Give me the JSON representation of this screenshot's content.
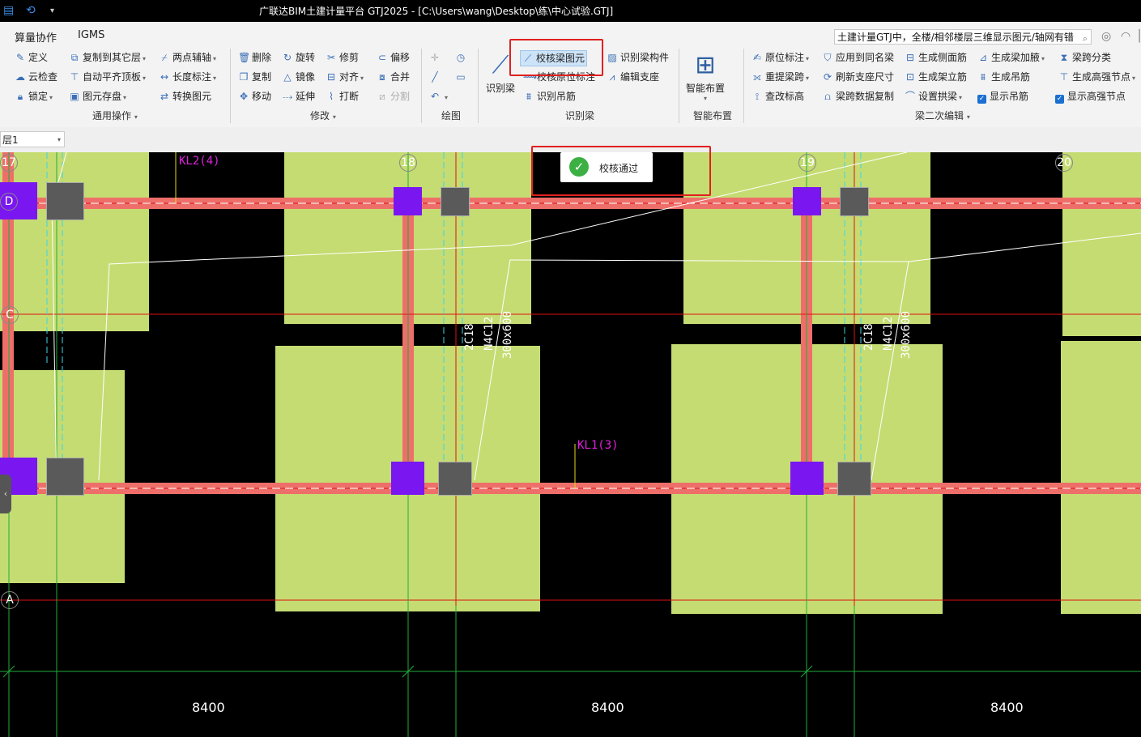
{
  "window": {
    "title": "广联达BIM土建计量平台 GTJ2025 - [C:\\Users\\wang\\Desktop\\练\\中心试验.GTJ]"
  },
  "menu": {
    "items": [
      "算量协作",
      "IGMS"
    ],
    "search_value": "土建计量GTJ中，全楼/相邻楼层三维显示图元/轴网有错"
  },
  "ribbon": {
    "general": {
      "label": "通用操作",
      "define": "定义",
      "cloud_check": "云检查",
      "lock": "锁定",
      "copy_to_floor": "复制到其它层",
      "auto_align_top": "自动平齐顶板",
      "save_element": "图元存盘",
      "two_point_axis": "两点辅轴",
      "length_dim": "长度标注",
      "convert_element": "转换图元"
    },
    "modify": {
      "label": "修改",
      "delete": "删除",
      "rotate": "旋转",
      "trim": "修剪",
      "offset": "偏移",
      "copy": "复制",
      "mirror": "镜像",
      "align": "对齐",
      "merge": "合并",
      "move": "移动",
      "extend": "延伸",
      "break": "打断",
      "split": "分割"
    },
    "draw": {
      "label": "绘图"
    },
    "recognize_beam": {
      "label": "识别梁",
      "big_button": "识别梁",
      "check_beam": "校核梁图元",
      "check_in_situ": "校核原位标注",
      "recognize_hanger": "识别吊筋",
      "recognize_component": "识别梁构件",
      "edit_support": "编辑支座"
    },
    "smart": {
      "label": "智能布置",
      "big_button": "智能布置"
    },
    "beam_edit": {
      "label": "梁二次编辑",
      "in_situ_mark": "原位标注",
      "re_extract_span": "重提梁跨",
      "check_elevation": "查改标高",
      "apply_same_name": "应用到同名梁",
      "refresh_support": "刷新支座尺寸",
      "span_data_copy": "梁跨数据复制",
      "gen_side_rebar": "生成侧面筋",
      "gen_frame_rebar": "生成架立筋",
      "set_arch": "设置拱梁",
      "gen_haunch": "生成梁加腋",
      "gen_hanger": "生成吊筋",
      "show_hanger": "显示吊筋",
      "span_classify": "梁跨分类",
      "gen_high_node": "生成高强节点",
      "show_high_node": "显示高强节点"
    }
  },
  "layer": {
    "selected": "层1"
  },
  "canvas": {
    "axes_x": [
      "17",
      "18",
      "19",
      "20"
    ],
    "axes_y": [
      "D",
      "C",
      "A"
    ],
    "beam_labels": [
      "KL2(4)",
      "KL1(3)"
    ],
    "rebar_note_1": [
      "2C18",
      "N4C12",
      "300x600"
    ],
    "rebar_note_2": [
      "2C18",
      "N4C12",
      "300x600"
    ],
    "dims": [
      "8400",
      "8400",
      "8400"
    ]
  },
  "toast": {
    "message": "校核通过"
  }
}
